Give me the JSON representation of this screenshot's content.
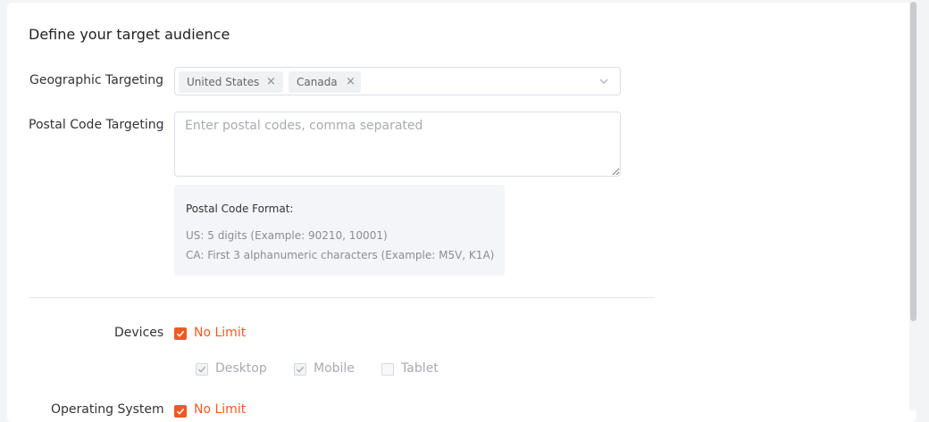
{
  "section_title": "Define your target audience",
  "geo": {
    "label": "Geographic Targeting",
    "tags": [
      "United States",
      "Canada"
    ],
    "remove_glyph": "×"
  },
  "postal": {
    "label": "Postal Code Targeting",
    "placeholder": "Enter postal codes, comma separated",
    "value": "",
    "hint_title": "Postal Code Format:",
    "hint_lines": [
      "US: 5 digits (Example: 90210, 10001)",
      "CA: First 3 alphanumeric characters (Example: M5V, K1A)"
    ]
  },
  "devices": {
    "label": "Devices",
    "no_limit": {
      "label": "No Limit",
      "checked": true
    },
    "options": [
      {
        "label": "Desktop",
        "checked": true,
        "disabled": true
      },
      {
        "label": "Mobile",
        "checked": true,
        "disabled": true
      },
      {
        "label": "Tablet",
        "checked": false,
        "disabled": true
      }
    ]
  },
  "operating_system": {
    "label": "Operating System",
    "no_limit": {
      "label": "No Limit",
      "checked": true
    }
  },
  "colors": {
    "accent": "#f05a22",
    "disabled_text": "#a8abb2",
    "border": "#dcdfe6"
  },
  "icons": {
    "remove": "close-icon",
    "dropdown": "chevron-down-icon",
    "check": "check-icon"
  }
}
